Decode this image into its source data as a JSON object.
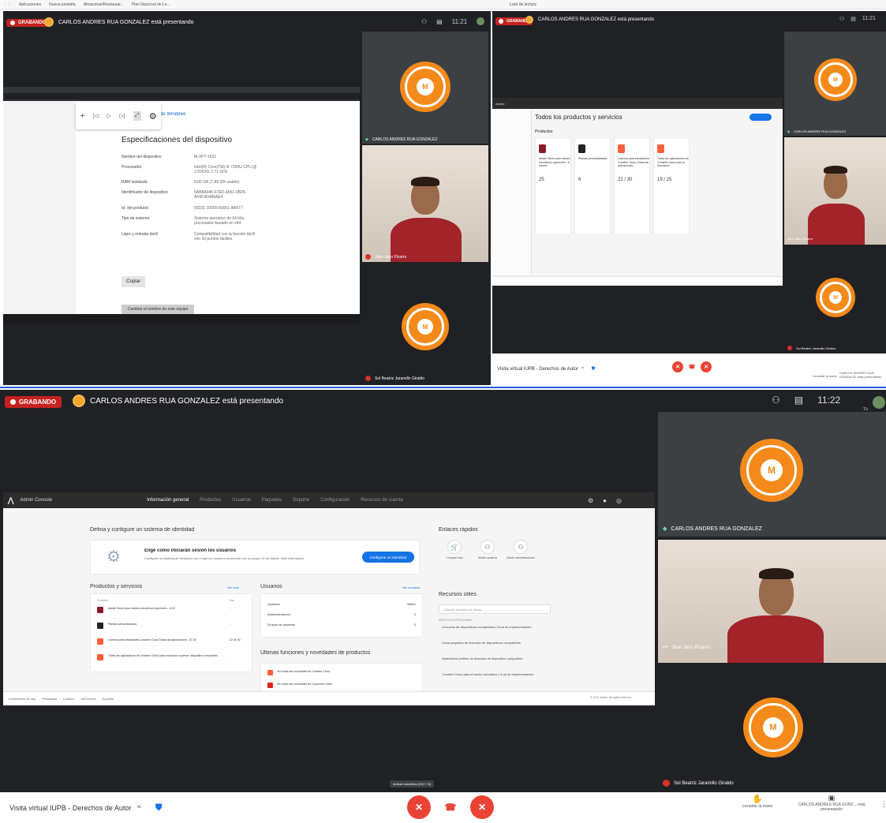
{
  "browser_bar": {
    "bookmarks": [
      "Aplicaciones",
      "Nueva pestaña",
      "Almacenar/Restaurar...",
      "Plan Nacional de Le..."
    ],
    "reading_list": "Lista de lectura"
  },
  "panel_tl": {
    "rec_label": "GRABANDO",
    "presenting": "CARLOS ANDRES RUA GONZALEZ está presentando",
    "time": "11:21",
    "pdf_heading": "Especificaciones del dispositivo",
    "pdf_link": "d de Windows",
    "specs": [
      {
        "k": "Nombre del dispositivo",
        "v": "M-XPT-1621"
      },
      {
        "k": "Procesador",
        "v": "Intel(R) Core(TM) i5-7200U CPU @ 2.50GHz 2.71 GHz"
      },
      {
        "k": "RAM instalada",
        "v": "8,00 GB (7,89 GB usable)"
      },
      {
        "k": "Identificador de dispositivo",
        "v": "5AB8A04F-F2E6-4A51-9B26-AF6F9D489AE4"
      },
      {
        "k": "Id. del producto",
        "v": "00331-10000-00001-AA077"
      },
      {
        "k": "Tipo de sistema",
        "v": "Sistema operativo de 64 bits, procesador basado en x64"
      },
      {
        "k": "Lápiz y entrada táctil",
        "v": "Compatibilidad con la función táctil con 10 puntos táctiles"
      }
    ],
    "copy_button": "Copiar",
    "bottom_button": "Cambiar el nombre de este equipo",
    "p1_name": "CARLOS ANDRES RUA GONZALEZ",
    "p2_name": "Jhon Jairo Pizarro",
    "p3_name": "Sol Beatriz Jaramillo Giraldo"
  },
  "panel_tr": {
    "rec_label": "GRABANDO",
    "presenting": "CARLOS ANDRES RUA GONZALEZ está presentando",
    "time": "11:21",
    "page_title": "Todos los productos y servicios",
    "products_label": "Productos",
    "cards": [
      {
        "title": "Adobe Stock para niveles educativos superiores - 6 meses",
        "value": "25"
      },
      {
        "title": "Plantas personalizadas",
        "value": "6"
      },
      {
        "title": "Licencia para estudiantes Creative Cloud Todas las aplicaciones",
        "value": "22 / 30"
      },
      {
        "title": "Todas las aplicaciones de Creative Cloud para la educación",
        "value": "19 / 25"
      }
    ],
    "meeting_title": "Visita virtual IUPB - Derechos de Autor",
    "p1_name": "CARLOS ANDRES RUA GONZALEZ",
    "p2_name": "Jhon Jairo Pizarro",
    "p3_name": "Sol Beatriz Jaramillo Giraldo",
    "raise_hand": "Levantar la mano",
    "presenting_short": "CARLOS ANDRES RUA GONZALEZ está presentando"
  },
  "panel_bottom": {
    "rec_label": "GRABANDO",
    "presenting": "CARLOS ANDRES RUA GONZALEZ está presentando",
    "time": "11:22",
    "tu_label": "Tú",
    "admin": {
      "brand": "Admin Console",
      "nav": [
        "Información general",
        "Productos",
        "Usuarios",
        "Paquetes",
        "Soporte",
        "Configuración",
        "Recursos de cuenta"
      ],
      "identity_title": "Defina y configure un sistema de identidad",
      "identity_subtitle": "Elige cómo iniciarán sesión los usuarios",
      "identity_text": "Configure un sistema de identidad con el que los usuarios accederán con su propio ID de Adobe. Más información",
      "identity_button": "Configurar un identidad",
      "quick_links_title": "Enlaces rápidos",
      "quick_links": [
        "Comprar más",
        "Añadir usuarios",
        "Añadir administradores"
      ],
      "products_title": "Productos y servicios",
      "products_more": "Ver todo",
      "products_header": [
        "Producto",
        "Uso"
      ],
      "products": [
        {
          "name": "Adobe Stock para niveles educativos superiores - 6.00",
          "val": "-"
        },
        {
          "name": "Plantas personalizadas",
          "val": "-"
        },
        {
          "name": "Licencia para estudiantes Creative Cloud Todas las aplicaciones - 67.00",
          "val": "22 de 30"
        },
        {
          "name": "Todas las aplicaciones de Creative Cloud para educación superior: dispositivo compartido",
          "val": "-"
        }
      ],
      "users_title": "Usuarios",
      "users_more": "Ver usuarios",
      "users": [
        {
          "k": "Usuarios",
          "v": "33641"
        },
        {
          "k": "Administradores",
          "v": "2"
        },
        {
          "k": "Grupos de usuarios",
          "v": "0"
        }
      ],
      "news_title": "Últimas funciones y novedades de productos",
      "news": [
        "Ver todas las novedades de Creative Cloud",
        "Ver todas las novedades de Document Cloud"
      ],
      "resources_title": "Recursos útiles",
      "search_placeholder": "Buscar artículos de ayuda",
      "resources_sub": "ARTÍCULOS POPULARES",
      "resources": [
        "Licencias de dispositivos compartidos | Guía de implementación",
        "Crear paquetes de licencias de dispositivos compartidos",
        "Administrar perfiles de licencias de dispositivo compartido",
        "Creative Cloud para el sector educativo | Guía de implementación"
      ],
      "footer_links": [
        "Condiciones de uso",
        "Privacidad",
        "Cookies",
        "AdChoices",
        "Español"
      ],
      "footer_copy": "© 2021 Adobe. All rights reserved."
    },
    "p1_name": "CARLOS ANDRES RUA GONZALEZ",
    "p2_name": "Jhon Jairo Pizarro",
    "p3_name": "Sol Beatriz Jaramillo Giraldo",
    "tooltip": "Activar micrófono (Ctrl + D)",
    "meeting_title": "Visita virtual IUPB - Derechos de Autor",
    "raise_hand": "Levantar la mano",
    "presenting_short": "CARLOS ANDRES RUA GONZ... está presentando"
  },
  "colors": {
    "rec": "#c5221f",
    "meet_bg": "#202124",
    "tile": "#3c4043",
    "emblem": "#f48a1a",
    "admin_blue": "#1473e6",
    "separator": "#2a56d6"
  }
}
